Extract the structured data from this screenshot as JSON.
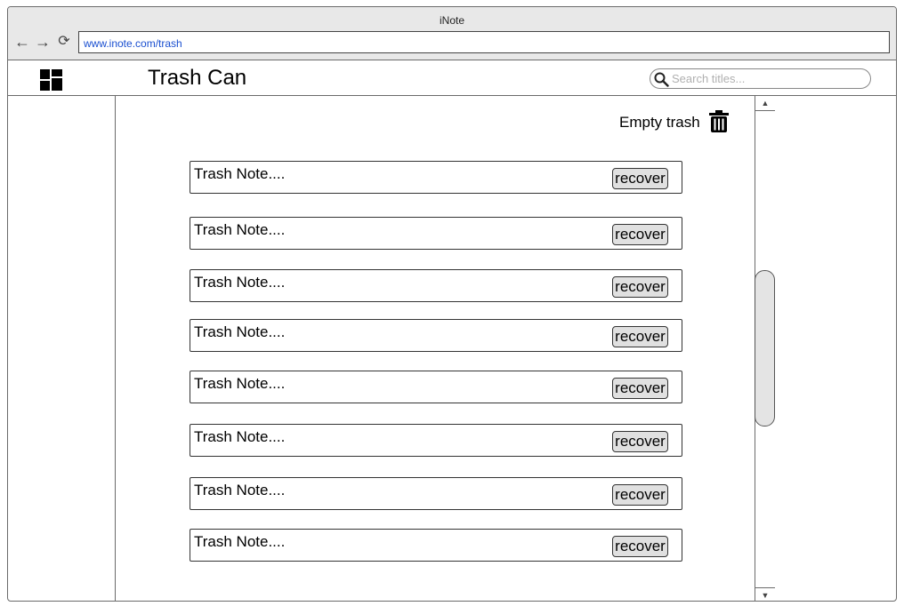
{
  "browser": {
    "window_title": "iNote",
    "url": "www.inote.com/trash",
    "back_glyph": "←",
    "forward_glyph": "→",
    "reload_glyph": "⟳"
  },
  "header": {
    "title": "Trash Can",
    "search_placeholder": "Search titles...",
    "search_value": ""
  },
  "actions": {
    "empty_trash_label": "Empty trash"
  },
  "notes": [
    {
      "title": "Trash Note....",
      "recover_label": "recover"
    },
    {
      "title": "Trash Note....",
      "recover_label": "recover"
    },
    {
      "title": "Trash Note....",
      "recover_label": "recover"
    },
    {
      "title": "Trash Note....",
      "recover_label": "recover"
    },
    {
      "title": "Trash Note....",
      "recover_label": "recover"
    },
    {
      "title": "Trash Note....",
      "recover_label": "recover"
    },
    {
      "title": "Trash Note....",
      "recover_label": "recover"
    },
    {
      "title": "Trash Note....",
      "recover_label": "recover"
    }
  ],
  "scrollbar": {
    "up_glyph": "▲",
    "down_glyph": "▼"
  },
  "icons": [
    "back-icon",
    "forward-icon",
    "reload-icon",
    "dashboard-grid-icon",
    "search-icon",
    "trash-icon"
  ],
  "colors": {
    "url_text": "#1a4fd0",
    "button_bg": "#e0e0e0",
    "chrome_bg": "#e8e8e8"
  }
}
